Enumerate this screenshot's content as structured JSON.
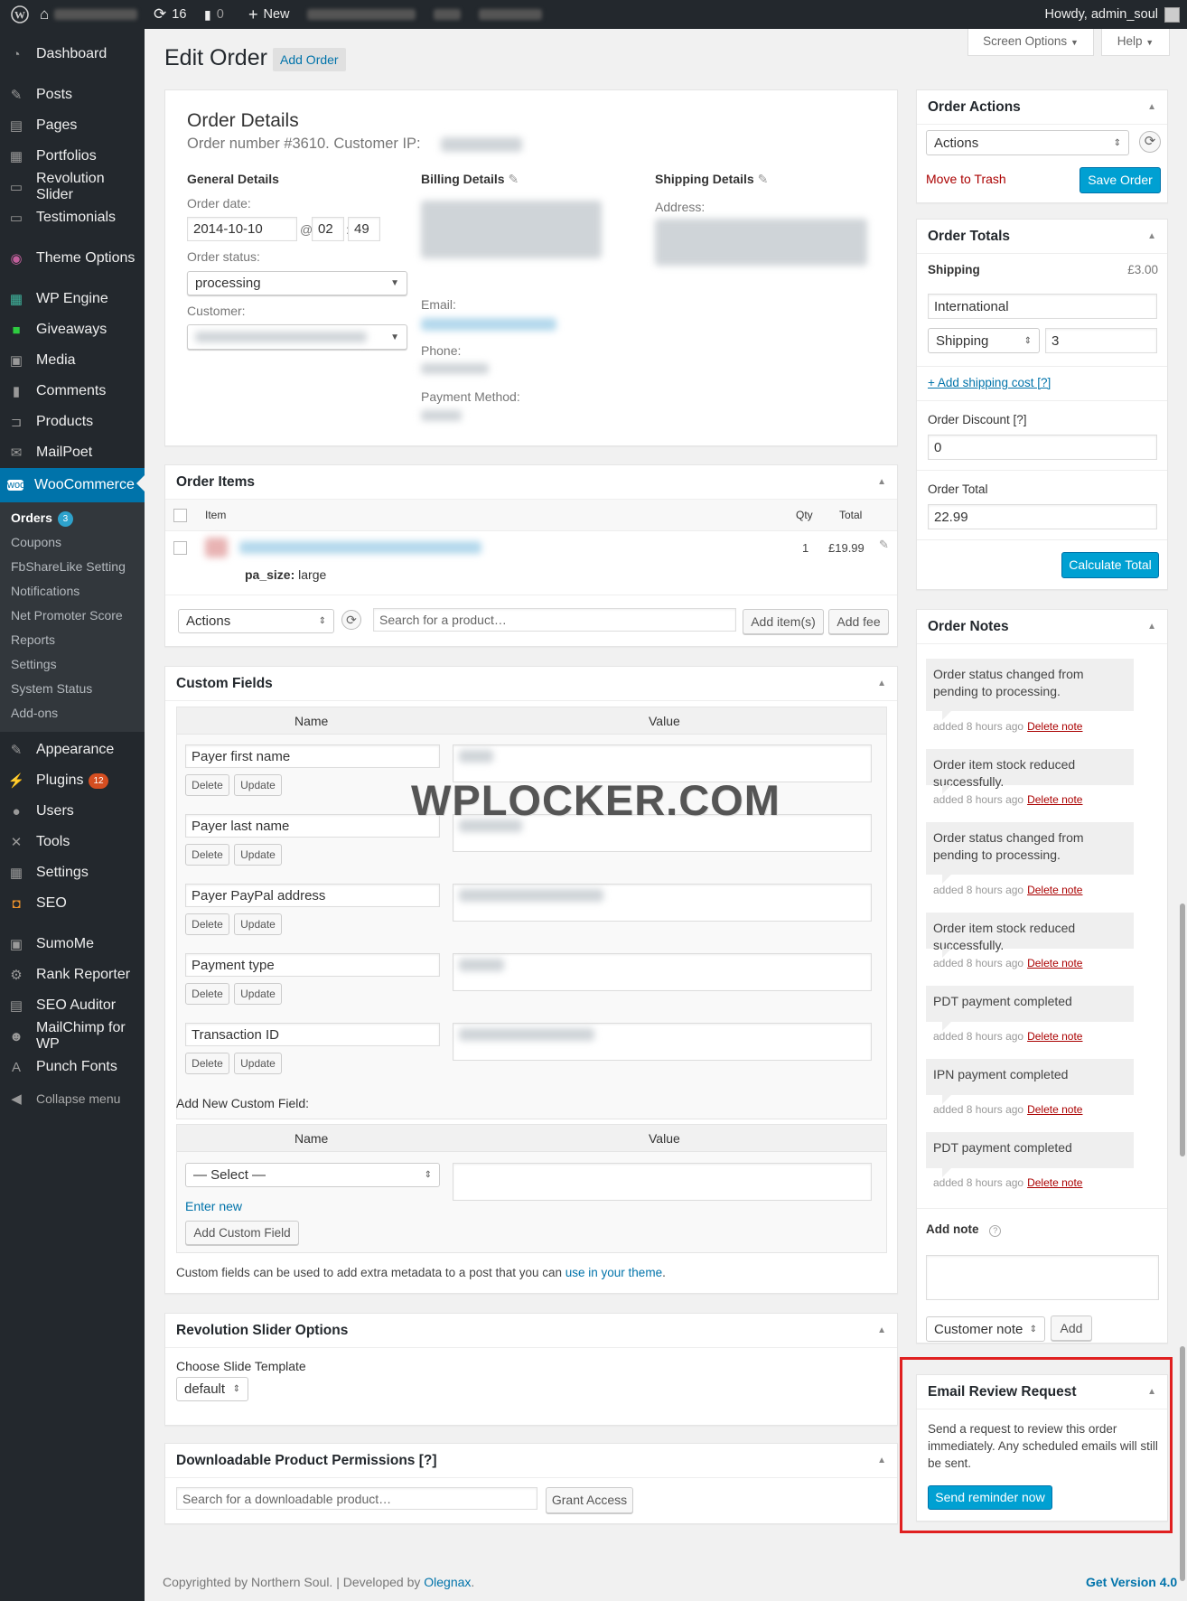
{
  "adminbar": {
    "updates": "16",
    "comments": "0",
    "new": "New",
    "howdy": "Howdy, admin_soul"
  },
  "sidebar": {
    "items": [
      "Dashboard",
      "Posts",
      "Pages",
      "Portfolios",
      "Revolution Slider",
      "Testimonials",
      "Theme Options",
      "WP Engine",
      "Giveaways",
      "Media",
      "Comments",
      "Products",
      "MailPoet",
      "WooCommerce",
      "Appearance",
      "Plugins",
      "Users",
      "Tools",
      "Settings",
      "SEO",
      "SumoMe",
      "Rank Reporter",
      "SEO Auditor",
      "MailChimp for WP",
      "Punch Fonts"
    ],
    "collapse": "Collapse menu",
    "plugins_badge": "12",
    "submenu": [
      "Orders",
      "Coupons",
      "FbShareLike Setting",
      "Notifications",
      "Net Promoter Score",
      "Reports",
      "Settings",
      "System Status",
      "Add-ons"
    ],
    "orders_badge": "3",
    "colors": {
      "bg": "#23282d",
      "active": "#0073aa",
      "badge_blue": "#2ea2cc",
      "badge_red": "#d54e21"
    }
  },
  "header": {
    "title": "Edit Order",
    "add_order": "Add Order",
    "screen_options": "Screen Options",
    "help": "Help"
  },
  "order_details": {
    "title": "Order Details",
    "subtitle": "Order number #3610. Customer IP:",
    "general": "General Details",
    "order_date_label": "Order date:",
    "date": "2014-10-10",
    "at": "@",
    "hour": "02",
    "colon": ":",
    "minute": "49",
    "order_status_label": "Order status:",
    "status": "processing",
    "customer_label": "Customer:",
    "billing": "Billing Details",
    "email_label": "Email:",
    "phone_label": "Phone:",
    "payment_method_label": "Payment Method:",
    "shipping": "Shipping Details",
    "address_label": "Address:"
  },
  "order_items": {
    "title": "Order Items",
    "col_item": "Item",
    "col_qty": "Qty",
    "col_total": "Total",
    "qty": "1",
    "total": "£19.99",
    "meta_key": "pa_size:",
    "meta_val": "large",
    "actions": "Actions",
    "search_placeholder": "Search for a product…",
    "add_items": "Add item(s)",
    "add_fee": "Add fee"
  },
  "custom_fields": {
    "title": "Custom Fields",
    "col_name": "Name",
    "col_value": "Value",
    "rows": [
      "Payer first name",
      "Payer last name",
      "Payer PayPal address",
      "Payment type",
      "Transaction ID"
    ],
    "delete": "Delete",
    "update": "Update",
    "add_new": "Add New Custom Field:",
    "select": "— Select —",
    "enter_new": "Enter new",
    "add_field": "Add Custom Field",
    "help_pre": "Custom fields can be used to add extra metadata to a post that you can ",
    "help_link": "use in your theme",
    "help_post": "."
  },
  "rev_slider": {
    "title": "Revolution Slider Options",
    "label": "Choose Slide Template",
    "value": "default"
  },
  "downloads": {
    "title": "Downloadable Product Permissions [?]",
    "placeholder": "Search for a downloadable product…",
    "grant": "Grant Access"
  },
  "order_actions": {
    "title": "Order Actions",
    "select": "Actions",
    "trash": "Move to Trash",
    "save": "Save Order"
  },
  "order_totals": {
    "title": "Order Totals",
    "shipping_label": "Shipping",
    "shipping_value": "£3.00",
    "shipping_name": "International",
    "shipping_method": "Shipping",
    "shipping_cost": "3",
    "add_shipping": "+ Add shipping cost [?]",
    "discount_label": "Order Discount [?]",
    "discount": "0",
    "total_label": "Order Total",
    "total": "22.99",
    "calc": "Calculate Total"
  },
  "order_notes": {
    "title": "Order Notes",
    "notes": [
      "Order status changed from pending to processing.",
      "Order item stock reduced successfully.",
      "Order status changed from pending to processing.",
      "Order item stock reduced successfully.",
      "PDT payment completed",
      "IPN payment completed",
      "PDT payment completed"
    ],
    "added": "added 8 hours ago",
    "delete": "Delete note",
    "add_note": "Add note",
    "note_type": "Customer note",
    "add": "Add"
  },
  "review": {
    "title": "Email Review Request",
    "text": "Send a request to review this order immediately. Any scheduled emails will still be sent.",
    "button": "Send reminder now"
  },
  "watermark": "WPLOCKER.COM",
  "footer": {
    "left": "Copyrighted by Northern Soul. | Developed by ",
    "link": "Olegnax",
    "dot": ".",
    "version": "Get Version 4.0"
  }
}
